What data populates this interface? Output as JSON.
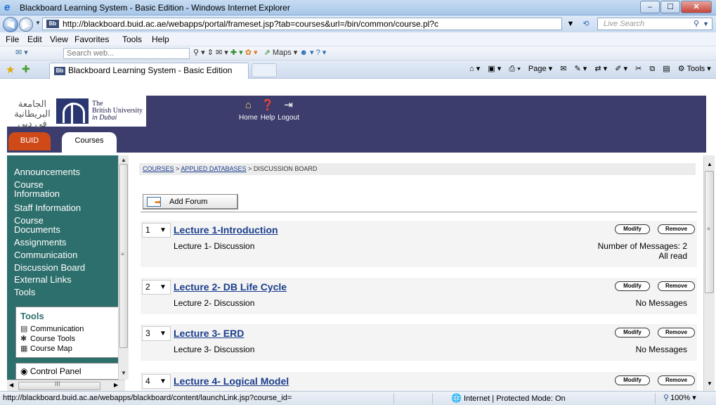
{
  "window": {
    "title": "Blackboard Learning System - Basic Edition - Windows Internet Explorer",
    "minimize": "–",
    "maximize": "☐",
    "close": "✕"
  },
  "address_bar": {
    "url": "http://blackboard.buid.ac.ae/webapps/portal/frameset.jsp?tab=courses&url=/bin/common/course.pl?c",
    "favicon": "Bb",
    "live_search_placeholder": "Live Search"
  },
  "menu": {
    "items": [
      "File",
      "Edit",
      "View",
      "Favorites",
      "Tools",
      "Help"
    ]
  },
  "search_toolbar": {
    "placeholder": "Search web...",
    "maps_label": "Maps"
  },
  "tab_bar": {
    "tab_title": "Blackboard Learning System - Basic Edition",
    "tab_favicon": "Bb",
    "commands": [
      "Page",
      "Tools"
    ]
  },
  "header": {
    "logo_arabic": "الجامعة البريطانية في دبي",
    "logo_text": [
      "The",
      "British University",
      "in Dubai"
    ],
    "nav": [
      {
        "label": "Home",
        "icon": "home-icon"
      },
      {
        "label": "Help",
        "icon": "help-icon"
      },
      {
        "label": "Logout",
        "icon": "logout-icon"
      }
    ],
    "tabs": [
      "BUID",
      "Courses"
    ]
  },
  "sidebar": {
    "links": [
      "Announcements",
      "Course Information",
      "Staff Information",
      "Course Documents",
      "Assignments",
      "Communication",
      "Discussion Board",
      "External Links",
      "Tools"
    ],
    "tools_heading": "Tools",
    "tools": [
      {
        "label": "Communication",
        "icon": "communication-icon"
      },
      {
        "label": "Course Tools",
        "icon": "course-tools-icon"
      },
      {
        "label": "Course Map",
        "icon": "course-map-icon"
      }
    ],
    "control_panel": "Control Panel"
  },
  "breadcrumb": {
    "items": [
      "COURSES",
      "APPLIED DATABASES",
      "DISCUSSION BOARD"
    ],
    "separator": ">"
  },
  "add_forum_label": "Add Forum",
  "forums": [
    {
      "num": "1",
      "title": "Lecture 1-Introduction",
      "description": "Lecture 1- Discussion",
      "messages": "Number of Messages: 2",
      "read_status": "All read"
    },
    {
      "num": "2",
      "title": "Lecture 2- DB Life Cycle",
      "description": "Lecture 2- Discussion",
      "messages": "No Messages",
      "read_status": ""
    },
    {
      "num": "3",
      "title": "Lecture 3- ERD",
      "description": "Lecture 3- Discussion",
      "messages": "No Messages",
      "read_status": ""
    },
    {
      "num": "4",
      "title": "Lecture 4- Logical Model",
      "description": "",
      "messages": "",
      "read_status": ""
    }
  ],
  "forum_buttons": {
    "modify": "Modify",
    "remove": "Remove"
  },
  "status_bar": {
    "url": "http://blackboard.buid.ac.ae/webapps/blackboard/content/launchLink.jsp?course_id=",
    "zone": "Internet | Protected Mode: On",
    "zoom": "100%"
  }
}
